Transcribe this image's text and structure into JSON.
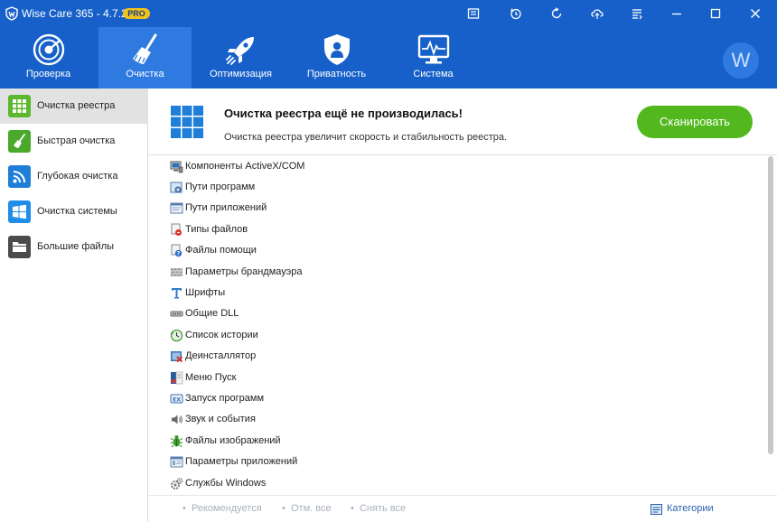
{
  "window": {
    "title": "Wise Care 365 - 4.7.2",
    "badge": "PRO",
    "controls": [
      "layout-icon",
      "history-icon",
      "refresh-icon",
      "cloud-icon",
      "menu-icon",
      "minimize-icon",
      "maximize-icon",
      "close-icon"
    ]
  },
  "nav": {
    "tabs": [
      {
        "label": "Проверка",
        "icon": "radar-icon"
      },
      {
        "label": "Очистка",
        "icon": "broom-icon",
        "active": true
      },
      {
        "label": "Оптимизация",
        "icon": "rocket-icon"
      },
      {
        "label": "Приватность",
        "icon": "shield-icon"
      },
      {
        "label": "Система",
        "icon": "monitor-icon"
      }
    ],
    "avatar": "W"
  },
  "sidebar": {
    "items": [
      {
        "label": "Очистка реестра",
        "icon": "registry-grid-icon",
        "color": "#5cb82c",
        "active": true
      },
      {
        "label": "Быстрая очистка",
        "icon": "broom-icon",
        "color": "#4aa82a"
      },
      {
        "label": "Глубокая очистка",
        "icon": "deep-clean-icon",
        "color": "#1f7fd8"
      },
      {
        "label": "Очистка системы",
        "icon": "windows-icon",
        "color": "#1e8ee8"
      },
      {
        "label": "Большие файлы",
        "icon": "folder-icon",
        "color": "#4b4b4b"
      }
    ]
  },
  "header": {
    "title": "Очистка реестра ещё не производилась!",
    "subtitle": "Очистка реестра увеличит скорость и стабильность реестра.",
    "scan_button": "Сканировать"
  },
  "registry": {
    "items": [
      {
        "label": "Компоненты ActiveX/COM",
        "icon": "activex-icon"
      },
      {
        "label": "Пути программ",
        "icon": "program-path-icon"
      },
      {
        "label": "Пути приложений",
        "icon": "app-path-icon"
      },
      {
        "label": "Типы файлов",
        "icon": "file-type-icon"
      },
      {
        "label": "Файлы помощи",
        "icon": "help-file-icon"
      },
      {
        "label": "Параметры брандмауэра",
        "icon": "firewall-icon"
      },
      {
        "label": "Шрифты",
        "icon": "font-icon"
      },
      {
        "label": "Общие DLL",
        "icon": "dll-icon"
      },
      {
        "label": "Список истории",
        "icon": "history-list-icon"
      },
      {
        "label": "Деинсталлятор",
        "icon": "uninstaller-icon"
      },
      {
        "label": "Меню Пуск",
        "icon": "start-menu-icon"
      },
      {
        "label": "Запуск программ",
        "icon": "startup-icon"
      },
      {
        "label": "Звук и события",
        "icon": "sound-icon"
      },
      {
        "label": "Файлы изображений",
        "icon": "image-file-icon"
      },
      {
        "label": "Параметры приложений",
        "icon": "app-settings-icon"
      },
      {
        "label": "Службы Windows",
        "icon": "services-icon"
      }
    ]
  },
  "footer": {
    "recommended": "Рекомендуется",
    "select_all": "Отм. все",
    "deselect_all": "Снять все",
    "categories": "Категории"
  },
  "colors": {
    "titlebar": "#1760c9",
    "nav_active": "#2f7ae0",
    "scan_button": "#52b81e",
    "link": "#2a5fb0"
  }
}
